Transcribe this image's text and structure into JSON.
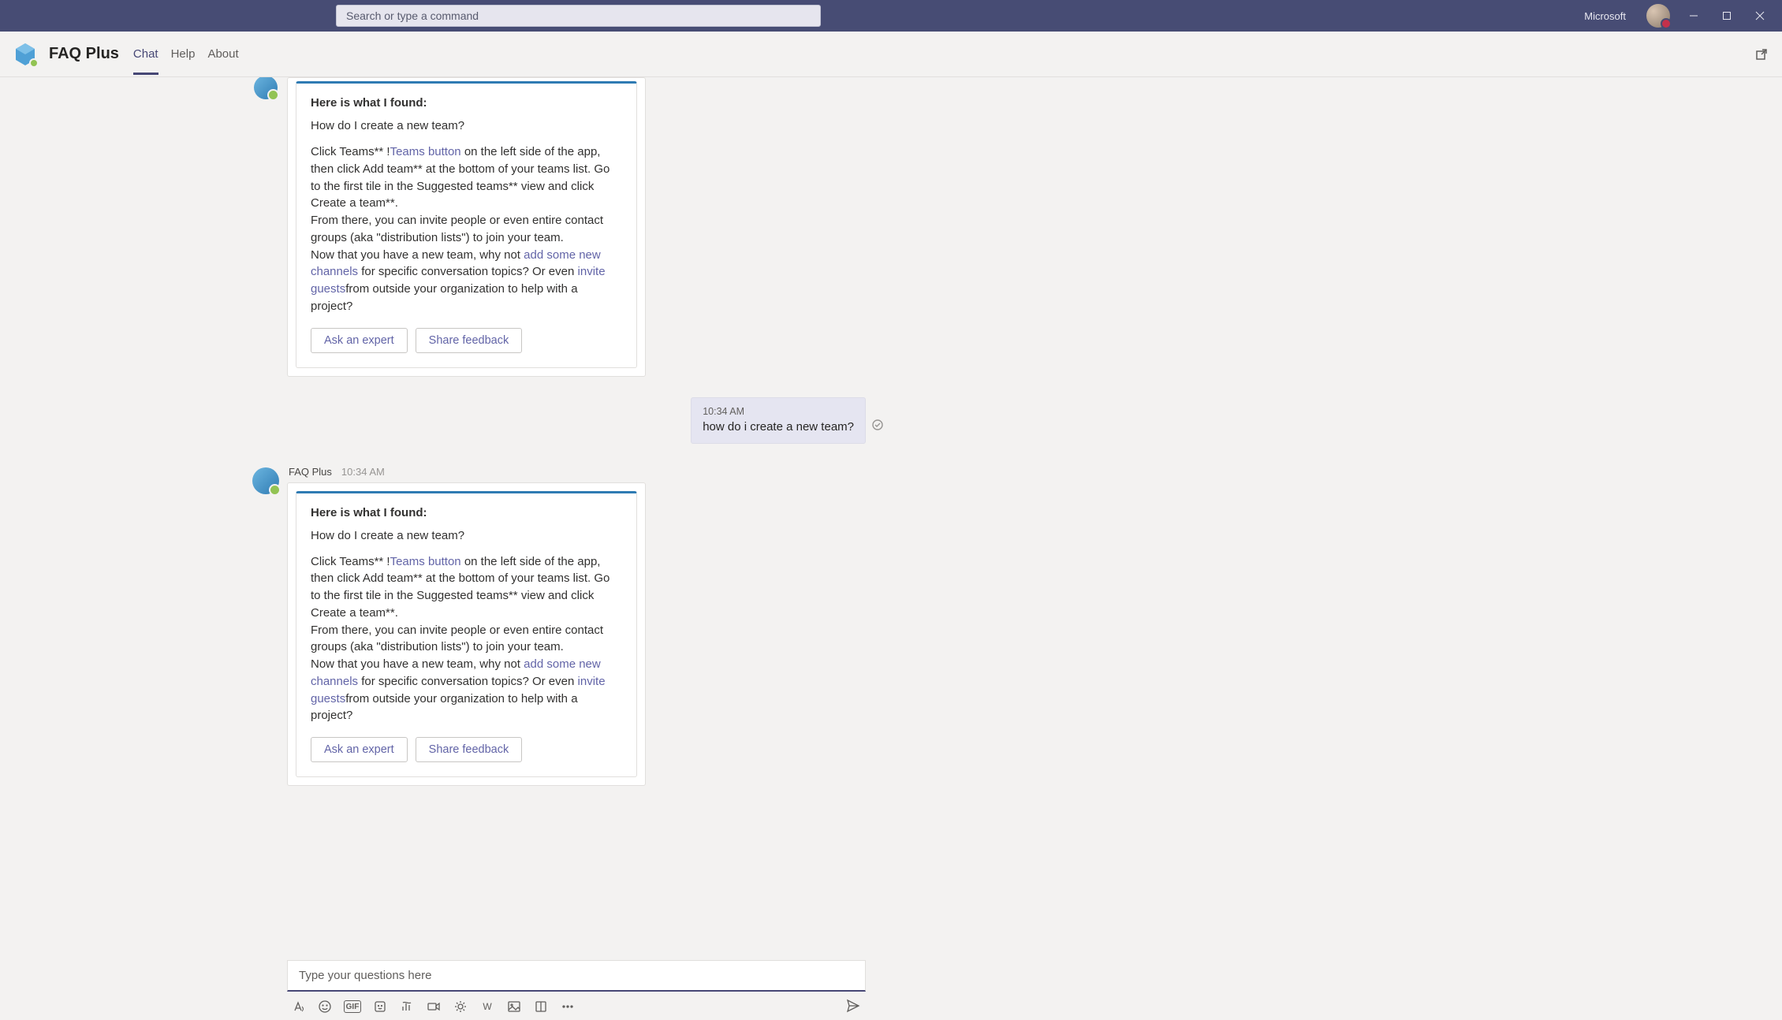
{
  "titlebar": {
    "search_placeholder": "Search or type a command",
    "org_label": "Microsoft"
  },
  "header": {
    "app_name": "FAQ Plus",
    "tabs": {
      "chat": "Chat",
      "help": "Help",
      "about": "About"
    }
  },
  "messages": {
    "bot_partial": {
      "title": "Here is what I found:",
      "question": "How do I create a new team?",
      "body_1": "Click Teams** !",
      "link_teams": "Teams button",
      "body_2": " on the left side of the app, then click Add team** at the bottom of your teams list. Go to the first tile in the Suggested teams** view and click Create a team**.",
      "body_3": "From there, you can invite people or even entire contact groups (aka \"distribution lists\") to join your team.",
      "body_4a": "Now that you have a new team, why not ",
      "link_channels": "add some new channels",
      "body_4b": " for specific conversation topics? Or even ",
      "link_guests": "invite guests",
      "body_4c": "from outside your organization to help with a project?",
      "btn_expert": "Ask an expert",
      "btn_feedback": "Share feedback"
    },
    "user": {
      "time": "10:34 AM",
      "text": "how do i create a new team?"
    },
    "bot_full": {
      "sender": "FAQ Plus",
      "time": "10:34 AM",
      "title": "Here is what I found:",
      "question": "How do I create a new team?",
      "body_1": "Click Teams** !",
      "link_teams": "Teams button",
      "body_2": " on the left side of the app, then click Add team** at the bottom of your teams list. Go to the first tile in the Suggested teams** view and click Create a team**.",
      "body_3": "From there, you can invite people or even entire contact groups (aka \"distribution lists\") to join your team.",
      "body_4a": "Now that you have a new team, why not ",
      "link_channels": "add some new channels",
      "body_4b": " for specific conversation topics? Or even ",
      "link_guests": "invite guests",
      "body_4c": "from outside your organization to help with a project?",
      "btn_expert": "Ask an expert",
      "btn_feedback": "Share feedback"
    }
  },
  "compose": {
    "placeholder": "Type your questions here"
  }
}
